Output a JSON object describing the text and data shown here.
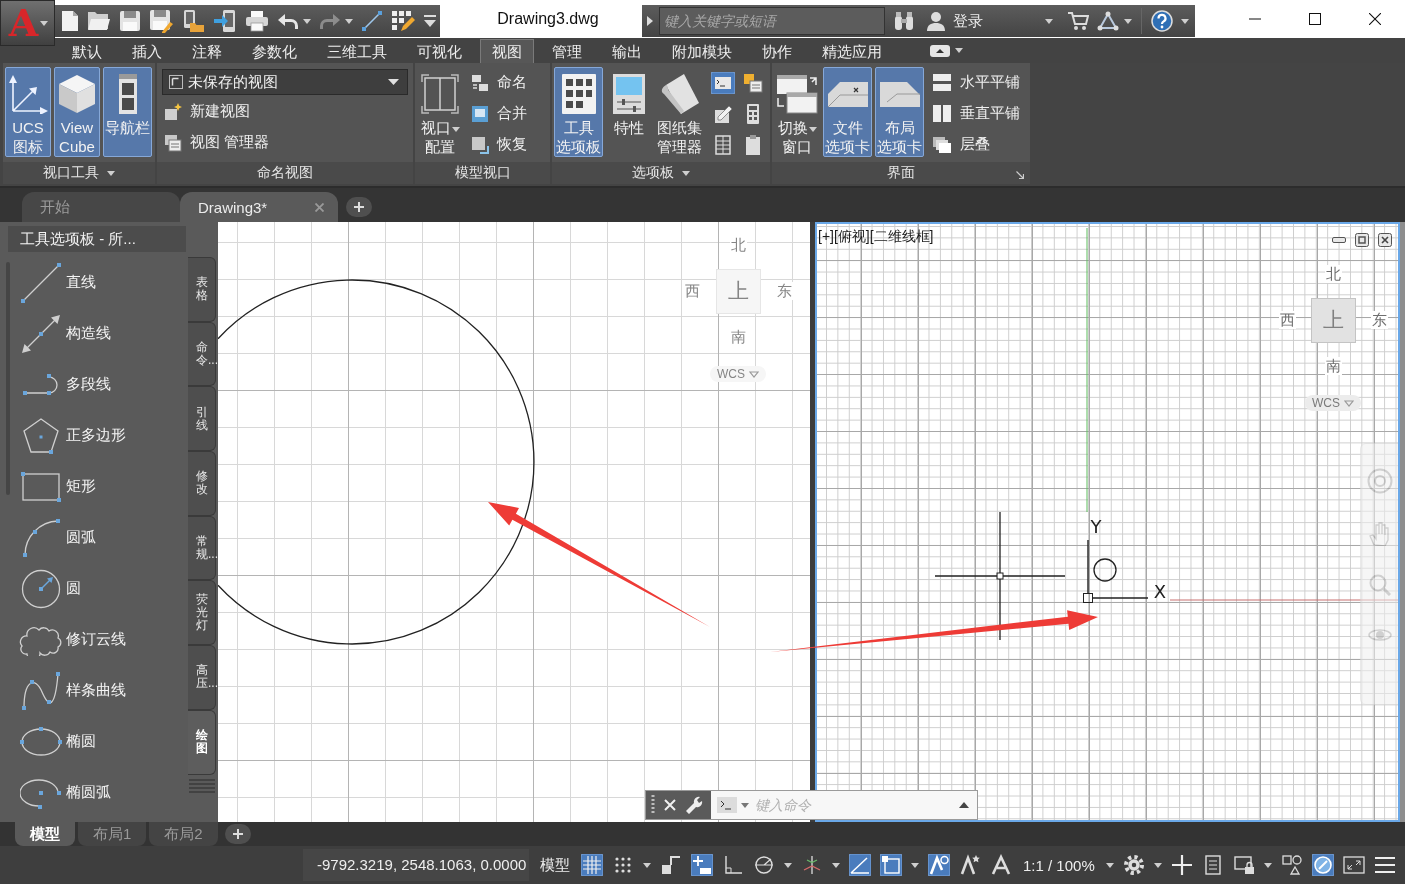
{
  "app": {
    "logo": "A",
    "title": "Drawing3.dwg"
  },
  "quick_access": [
    {
      "kind": "new",
      "menu": false,
      "disabled": false
    },
    {
      "kind": "open",
      "menu": false,
      "disabled": false
    },
    {
      "kind": "save",
      "menu": false,
      "disabled": false
    },
    {
      "kind": "save-as",
      "menu": false,
      "disabled": false
    },
    {
      "kind": "open-web",
      "menu": false,
      "disabled": false
    },
    {
      "kind": "save-web",
      "menu": false,
      "disabled": false
    },
    {
      "kind": "print",
      "menu": false,
      "disabled": false
    },
    {
      "kind": "undo",
      "menu": true,
      "disabled": false
    },
    {
      "kind": "redo",
      "menu": true,
      "disabled": true
    },
    {
      "kind": "match",
      "menu": false,
      "disabled": false
    },
    {
      "kind": "workspace",
      "menu": false,
      "disabled": false
    },
    {
      "kind": "customize",
      "menu": false,
      "disabled": false
    }
  ],
  "search": {
    "placeholder": "键入关键字或短语"
  },
  "account": {
    "label": "登录"
  },
  "ribbon_tabs": [
    {
      "label": "默认",
      "selected": false
    },
    {
      "label": "插入",
      "selected": false
    },
    {
      "label": "注释",
      "selected": false
    },
    {
      "label": "参数化",
      "selected": false
    },
    {
      "label": "三维工具",
      "selected": false
    },
    {
      "label": "可视化",
      "selected": false
    },
    {
      "label": "视图",
      "selected": true
    },
    {
      "label": "管理",
      "selected": false
    },
    {
      "label": "输出",
      "selected": false
    },
    {
      "label": "附加模块",
      "selected": false
    },
    {
      "label": "协作",
      "selected": false
    },
    {
      "label": "精选应用",
      "selected": false
    }
  ],
  "ribbon_panels": [
    {
      "title": "视口工具",
      "menu": true,
      "launcher": false,
      "large": [
        {
          "kind": "ucs",
          "lines": [
            "UCS",
            "图标"
          ],
          "on": true,
          "menu": false
        },
        {
          "kind": "viewcube",
          "lines": [
            "View",
            "Cube"
          ],
          "on": true,
          "menu": false
        },
        {
          "kind": "navbar",
          "lines": [
            "导航栏"
          ],
          "on": true,
          "menu": false
        }
      ]
    },
    {
      "title": "命名视图",
      "menu": false,
      "launcher": false,
      "small": [
        {
          "kind": "dropdown",
          "value": "未保存的视图"
        },
        {
          "kind": "new-view",
          "label": "新建视图"
        },
        {
          "kind": "view-manager",
          "label": "视图 管理器"
        }
      ]
    },
    {
      "title": "模型视口",
      "menu": false,
      "launcher": false,
      "large": [
        {
          "kind": "viewport-config",
          "lines": [
            "视口",
            "配置"
          ],
          "on": false,
          "menu": true
        }
      ],
      "small": [
        {
          "kind": "named",
          "label": "命名"
        },
        {
          "kind": "join",
          "label": "合并"
        },
        {
          "kind": "restore",
          "label": "恢复"
        }
      ]
    },
    {
      "title": "选项板",
      "menu": true,
      "launcher": false,
      "large": [
        {
          "kind": "tool-palettes",
          "lines": [
            "工具",
            "选项板"
          ],
          "on": true,
          "menu": false
        },
        {
          "kind": "properties",
          "lines": [
            "特性"
          ],
          "on": false,
          "menu": false
        },
        {
          "kind": "sheet-set",
          "lines": [
            "图纸集",
            "管理器"
          ],
          "on": false,
          "menu": false
        }
      ],
      "icons": [
        {
          "kind": "command-line",
          "on": true
        },
        {
          "kind": "markup",
          "on": false
        },
        {
          "kind": "dbconnect",
          "on": false
        },
        {
          "kind": "calculator",
          "on": false
        },
        {
          "kind": "table",
          "on": false
        },
        {
          "kind": "clipboard",
          "on": false
        }
      ]
    },
    {
      "title": "界面",
      "menu": false,
      "launcher": true,
      "large": [
        {
          "kind": "switch-window",
          "lines": [
            "切换",
            "窗口"
          ],
          "on": false,
          "menu": true
        },
        {
          "kind": "file-tabs",
          "lines": [
            "文件",
            "选项卡"
          ],
          "on": true,
          "menu": false
        },
        {
          "kind": "layout-tabs",
          "lines": [
            "布局",
            "选项卡"
          ],
          "on": true,
          "menu": false
        }
      ],
      "small": [
        {
          "kind": "tile-h",
          "label": "水平平铺"
        },
        {
          "kind": "tile-v",
          "label": "垂直平铺"
        },
        {
          "kind": "cascade",
          "label": "层叠"
        }
      ]
    }
  ],
  "document_tabs": [
    {
      "label": "开始",
      "selected": false
    },
    {
      "label": "Drawing3*",
      "selected": true
    }
  ],
  "tool_palette": {
    "title": "工具选项板 - 所...",
    "tools": [
      {
        "kind": "line",
        "label": "直线"
      },
      {
        "kind": "xline",
        "label": "构造线"
      },
      {
        "kind": "polyline",
        "label": "多段线"
      },
      {
        "kind": "polygon",
        "label": "正多边形"
      },
      {
        "kind": "rectangle",
        "label": "矩形"
      },
      {
        "kind": "arc",
        "label": "圆弧"
      },
      {
        "kind": "circle",
        "label": "圆"
      },
      {
        "kind": "revcloud",
        "label": "修订云线"
      },
      {
        "kind": "spline",
        "label": "样条曲线"
      },
      {
        "kind": "ellipse",
        "label": "椭圆"
      },
      {
        "kind": "ellipse-arc",
        "label": "椭圆弧"
      }
    ],
    "tabs": [
      {
        "label": "表格",
        "selected": false
      },
      {
        "label": "命令...",
        "selected": false
      },
      {
        "label": "引线",
        "selected": false
      },
      {
        "label": "修改",
        "selected": false
      },
      {
        "label": "常规...",
        "selected": false
      },
      {
        "label": "荧光灯",
        "selected": false
      },
      {
        "label": "高压...",
        "selected": false
      },
      {
        "label": "绘图",
        "selected": true
      }
    ]
  },
  "viewports": [
    {
      "active": false,
      "compass": {
        "north": "北",
        "west": "西",
        "top": "上",
        "east": "东",
        "south": "南"
      },
      "ucs": "WCS"
    },
    {
      "active": true,
      "label": "[+][俯视][二维线框]",
      "compass": {
        "north": "北",
        "west": "西",
        "top": "上",
        "east": "东",
        "south": "南"
      },
      "ucs": "WCS",
      "axes": {
        "x": "X",
        "y": "Y"
      }
    }
  ],
  "command_line": {
    "placeholder": "键入命令"
  },
  "layout_tabs": [
    {
      "label": "模型",
      "selected": true
    },
    {
      "label": "布局1",
      "selected": false
    },
    {
      "label": "布局2",
      "selected": false
    }
  ],
  "status_bar": {
    "coordinates": "-9792.3219, 2548.1063, 0.0000",
    "items": [
      {
        "kind": "model",
        "label": "模型"
      },
      {
        "kind": "grid",
        "on": true
      },
      {
        "kind": "snap",
        "on": false
      },
      {
        "kind": "caret"
      },
      {
        "kind": "infer",
        "on": false
      },
      {
        "kind": "dynamic-input",
        "on": true
      },
      {
        "kind": "ortho",
        "on": false
      },
      {
        "kind": "polar",
        "on": false
      },
      {
        "kind": "caret"
      },
      {
        "kind": "isodraft",
        "on": false
      },
      {
        "kind": "caret"
      },
      {
        "kind": "tracking",
        "on": true
      },
      {
        "kind": "osnap",
        "on": true
      },
      {
        "kind": "caret"
      },
      {
        "kind": "annotation-visibility",
        "on": true
      },
      {
        "kind": "autoscale",
        "on": false
      },
      {
        "kind": "annotation-scale",
        "on": false
      },
      {
        "kind": "scale",
        "label": "1:1 / 100%"
      },
      {
        "kind": "caret"
      },
      {
        "kind": "workspace"
      },
      {
        "kind": "caret"
      },
      {
        "kind": "annotation-monitor"
      },
      {
        "kind": "quick-properties"
      },
      {
        "kind": "lock-ui"
      },
      {
        "kind": "caret"
      },
      {
        "kind": "isolate"
      },
      {
        "kind": "hardware",
        "on": true
      },
      {
        "kind": "clean-screen"
      },
      {
        "kind": "customize"
      }
    ]
  }
}
